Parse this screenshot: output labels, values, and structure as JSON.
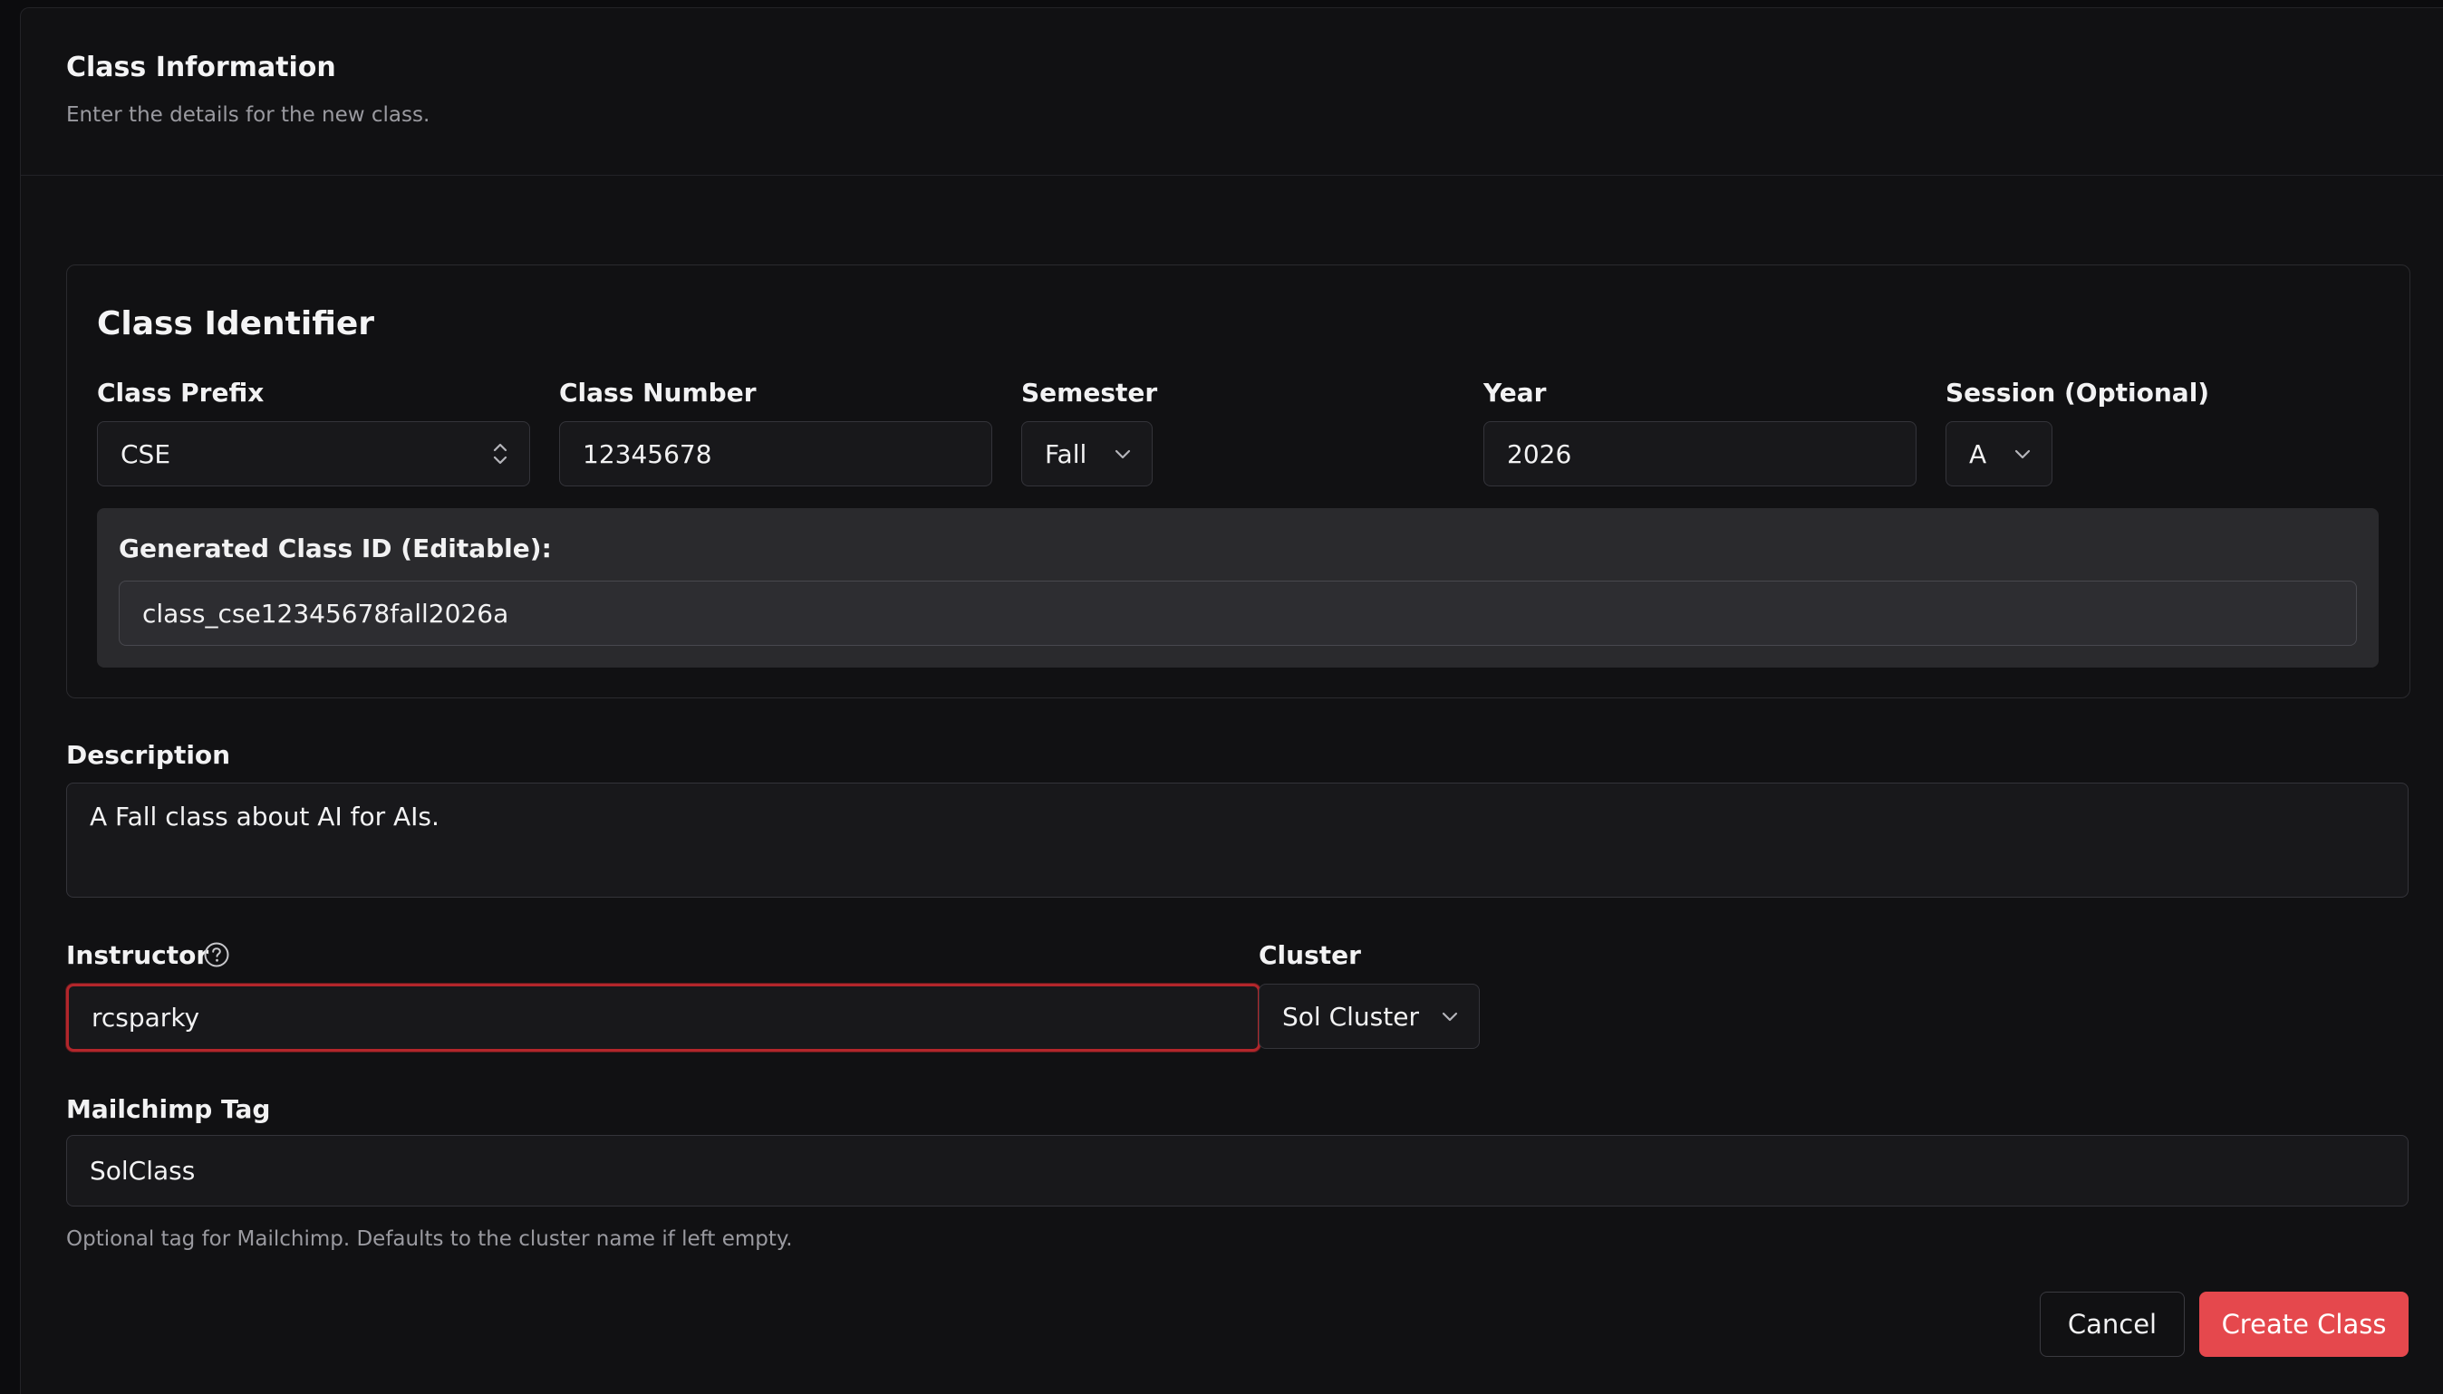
{
  "header": {
    "title": "Class Information",
    "subtitle": "Enter the details for the new class."
  },
  "identifier": {
    "title": "Class Identifier",
    "prefix": {
      "label": "Class Prefix",
      "value": "CSE"
    },
    "number": {
      "label": "Class Number",
      "value": "12345678"
    },
    "semester": {
      "label": "Semester",
      "value": "Fall"
    },
    "year": {
      "label": "Year",
      "value": "2026"
    },
    "session": {
      "label": "Session (Optional)",
      "value": "A"
    },
    "generated": {
      "label": "Generated Class ID (Editable):",
      "value": "class_cse12345678fall2026a"
    }
  },
  "description": {
    "label": "Description",
    "value": "A Fall class about AI for AIs."
  },
  "instructor": {
    "label": "Instructor",
    "value": "rcsparky",
    "help_icon": "question-circle-icon",
    "state": "error"
  },
  "cluster": {
    "label": "Cluster",
    "value": "Sol Cluster"
  },
  "mailchimp": {
    "label": "Mailchimp Tag",
    "value": "SolClass",
    "hint": "Optional tag for Mailchimp. Defaults to the cluster name if left empty."
  },
  "actions": {
    "cancel": "Cancel",
    "create": "Create Class"
  },
  "colors": {
    "background": "#111113",
    "accent": "#e5484d",
    "error_border": "#b3262b",
    "field_bg": "#18181b"
  }
}
